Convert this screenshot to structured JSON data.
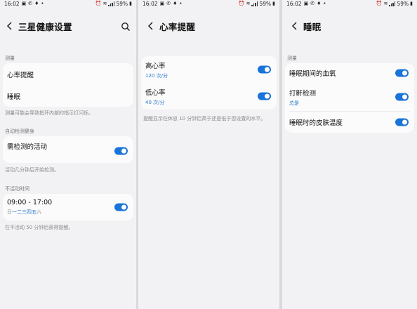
{
  "status": {
    "time": "16:02",
    "battery": "59%"
  },
  "screen1": {
    "title": "三星健康设置",
    "sections": {
      "measure": "测量",
      "auto": "自动检测健身",
      "inactive": "不活动时间"
    },
    "rows": {
      "heart_rate_alerts": "心率提醒",
      "sleep": "睡眠",
      "detect_activities": "需检测的活动",
      "time_range": "09:00 - 17:00"
    },
    "days": [
      "日",
      "一",
      "二",
      "三",
      "四",
      "五",
      "六"
    ],
    "hints": {
      "measure": "测量可能会导致指环内部的指示灯闪烁。",
      "auto": "活动几分钟后开始检测。",
      "inactive": "在不活动 50 分钟后获得提醒。"
    }
  },
  "screen2": {
    "title": "心率提醒",
    "rows": [
      {
        "label": "高心率",
        "value": "120 次/分",
        "toggle_on": true
      },
      {
        "label": "低心率",
        "value": "40 次/分",
        "toggle_on": true
      }
    ],
    "hint": "提醒显示在休息 10 分钟后高于还是低于您设置的水平。"
  },
  "screen3": {
    "title": "睡眠",
    "section": "测量",
    "rows": [
      {
        "label": "睡眠期间的血氧",
        "sub": "",
        "toggle_on": true
      },
      {
        "label": "打鼾检测",
        "sub": "总是",
        "toggle_on": true
      },
      {
        "label": "睡眠时的皮肤温度",
        "sub": "",
        "toggle_on": true
      }
    ]
  },
  "colors": {
    "accent": "#1a73d8",
    "background": "#f2f2f4",
    "card": "#fbfbfc"
  }
}
